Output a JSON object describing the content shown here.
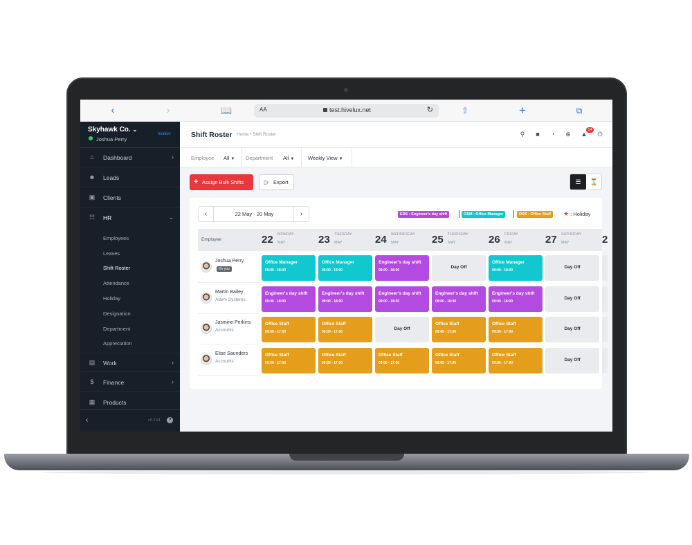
{
  "browser": {
    "text_size": "AA",
    "url": "test.hivelux.net"
  },
  "sidebar": {
    "company": "Skyhawk Co.",
    "user": "Joshua Perry",
    "logo_text": "hivelux",
    "items": [
      {
        "label": "Dashboard",
        "icon": "home-icon"
      },
      {
        "label": "Leads",
        "icon": "user-icon"
      },
      {
        "label": "Clients",
        "icon": "building-icon"
      },
      {
        "label": "HR",
        "icon": "users-icon"
      },
      {
        "label": "Work",
        "icon": "briefcase-icon"
      },
      {
        "label": "Finance",
        "icon": "dollar-icon"
      },
      {
        "label": "Products",
        "icon": "shop-icon"
      }
    ],
    "hr_subitems": [
      "Employees",
      "Leaves",
      "Shift Roster",
      "Attendance",
      "Holiday",
      "Designation",
      "Department",
      "Appreciation"
    ],
    "version": "v5.2.81"
  },
  "header": {
    "title": "Shift Roster",
    "breadcrumb": "Home • Shift Roster",
    "notification_count": "14"
  },
  "filters": {
    "employee_label": "Employee",
    "employee_value": "All",
    "department_label": "Department",
    "department_value": "All",
    "view_value": "Weekly View"
  },
  "actions": {
    "assign_label": "Assign Bulk Shifts",
    "export_label": "Export"
  },
  "roster": {
    "range": "22 May - 20 May",
    "legend": [
      {
        "label": "EDS : Engineer's day shift",
        "color": "#b44be1"
      },
      {
        "label": "OSM : Office Manager",
        "color": "#12c8cf"
      },
      {
        "label": "OSS : Office Staff",
        "color": "#e59e1c"
      }
    ],
    "holiday_label": ": Holiday",
    "employee_col": "Employee",
    "days": [
      {
        "num": "22",
        "name": "MONDAY",
        "month": "MAY"
      },
      {
        "num": "23",
        "name": "TUESDAY",
        "month": "MAY"
      },
      {
        "num": "24",
        "name": "WEDNESDAY",
        "month": "MAY"
      },
      {
        "num": "25",
        "name": "THURSDAY",
        "month": "MAY"
      },
      {
        "num": "26",
        "name": "FRIDAY",
        "month": "MAY"
      },
      {
        "num": "27",
        "name": "SATURDAY",
        "month": "MAY"
      },
      {
        "num": "2",
        "name": "",
        "month": ""
      }
    ],
    "employees": [
      {
        "name": "Joshua Perry",
        "sub": "It's you",
        "shifts": [
          {
            "title": "Office Manager",
            "hours": "09:00 - 18:00",
            "color": "#12c8cf"
          },
          {
            "title": "Office Manager",
            "hours": "09:00 - 18:00",
            "color": "#12c8cf"
          },
          {
            "title": "Engineer's day shift",
            "hours": "09:00 - 18:00",
            "color": "#b44be1"
          },
          {
            "title": "Day Off",
            "hours": "",
            "color": "#e9ebee"
          },
          {
            "title": "Office Manager",
            "hours": "09:00 - 18:00",
            "color": "#12c8cf"
          },
          {
            "title": "Day Off",
            "hours": "",
            "color": "#e9ebee"
          }
        ]
      },
      {
        "name": "Martin Bailey",
        "sub": "Alarm Systems",
        "shifts": [
          {
            "title": "Engineer's day shift",
            "hours": "09:00 - 18:00",
            "color": "#b44be1"
          },
          {
            "title": "Engineer's day shift",
            "hours": "09:00 - 18:00",
            "color": "#b44be1"
          },
          {
            "title": "Engineer's day shift",
            "hours": "09:00 - 18:00",
            "color": "#b44be1"
          },
          {
            "title": "Engineer's day shift",
            "hours": "09:00 - 18:00",
            "color": "#b44be1"
          },
          {
            "title": "Engineer's day shift",
            "hours": "09:00 - 18:00",
            "color": "#b44be1"
          },
          {
            "title": "Day Off",
            "hours": "",
            "color": "#e9ebee"
          }
        ]
      },
      {
        "name": "Jasmine Perkins",
        "sub": "Accounts",
        "shifts": [
          {
            "title": "Office Staff",
            "hours": "09:00 - 17:00",
            "color": "#e59e1c"
          },
          {
            "title": "Office Staff",
            "hours": "09:00 - 17:00",
            "color": "#e59e1c"
          },
          {
            "title": "Day Off",
            "hours": "",
            "color": "#e9ebee"
          },
          {
            "title": "Office Staff",
            "hours": "09:00 - 17:00",
            "color": "#e59e1c"
          },
          {
            "title": "Office Staff",
            "hours": "09:00 - 17:00",
            "color": "#e59e1c"
          },
          {
            "title": "Day Off",
            "hours": "",
            "color": "#e9ebee"
          }
        ]
      },
      {
        "name": "Elise Saunders",
        "sub": "Accounts",
        "shifts": [
          {
            "title": "Office Staff",
            "hours": "09:00 - 17:00",
            "color": "#e59e1c"
          },
          {
            "title": "Office Staff",
            "hours": "09:00 - 17:00",
            "color": "#e59e1c"
          },
          {
            "title": "Office Staff",
            "hours": "09:00 - 17:00",
            "color": "#e59e1c"
          },
          {
            "title": "Office Staff",
            "hours": "09:00 - 17:00",
            "color": "#e59e1c"
          },
          {
            "title": "Office Staff",
            "hours": "09:00 - 17:00",
            "color": "#e59e1c"
          },
          {
            "title": "Day Off",
            "hours": "",
            "color": "#e9ebee"
          }
        ]
      }
    ]
  }
}
